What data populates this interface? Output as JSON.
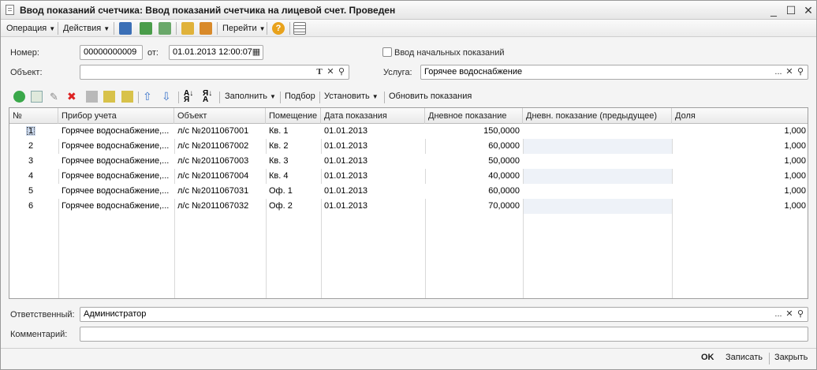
{
  "window": {
    "title": "Ввод показаний счетчика: Ввод показаний счетчика на лицевой счет. Проведен",
    "controls": [
      "_",
      "☐",
      "✕"
    ]
  },
  "menubar": {
    "operation": "Операция",
    "actions": "Действия",
    "goto": "Перейти"
  },
  "form": {
    "number_label": "Номер:",
    "number_value": "00000000009",
    "from_label": "от:",
    "date_value": "01.01.2013 12:00:07",
    "initial_checkbox_label": "Ввод начальных показаний",
    "object_label": "Объект:",
    "object_value": "",
    "service_label": "Услуга:",
    "service_value": "Горячее водоснабжение",
    "responsible_label": "Ответственный:",
    "responsible_value": "Администратор",
    "comment_label": "Комментарий:",
    "comment_value": "",
    "t_button": "T",
    "dots_button": "..."
  },
  "table_toolbar": {
    "fill": "Заполнить",
    "selection": "Подбор",
    "set": "Установить",
    "update": "Обновить показания"
  },
  "table": {
    "columns": [
      "№",
      "Прибор учета",
      "Объект",
      "Помещение",
      "Дата показания",
      "Дневное показание",
      "Дневн. показание (предыдущее)",
      "Доля"
    ],
    "rows": [
      {
        "n": "1",
        "device": "Горячее водоснабжение,...",
        "object": "л/с №2011067001",
        "room": "Кв. 1",
        "date": "01.01.2013",
        "day": "150,0000",
        "prev": "",
        "share": "1,000"
      },
      {
        "n": "2",
        "device": "Горячее водоснабжение,...",
        "object": "л/с №2011067002",
        "room": "Кв. 2",
        "date": "01.01.2013",
        "day": "60,0000",
        "prev": "",
        "share": "1,000"
      },
      {
        "n": "3",
        "device": "Горячее водоснабжение,...",
        "object": "л/с №2011067003",
        "room": "Кв. 3",
        "date": "01.01.2013",
        "day": "50,0000",
        "prev": "",
        "share": "1,000"
      },
      {
        "n": "4",
        "device": "Горячее водоснабжение,...",
        "object": "л/с №2011067004",
        "room": "Кв. 4",
        "date": "01.01.2013",
        "day": "40,0000",
        "prev": "",
        "share": "1,000"
      },
      {
        "n": "5",
        "device": "Горячее водоснабжение,...",
        "object": "л/с №2011067031",
        "room": "Оф. 1",
        "date": "01.01.2013",
        "day": "60,0000",
        "prev": "",
        "share": "1,000"
      },
      {
        "n": "6",
        "device": "Горячее водоснабжение,...",
        "object": "л/с №2011067032",
        "room": "Оф. 2",
        "date": "01.01.2013",
        "day": "70,0000",
        "prev": "",
        "share": "1,000"
      }
    ]
  },
  "footer": {
    "ok": "OK",
    "save": "Записать",
    "close": "Закрыть"
  }
}
